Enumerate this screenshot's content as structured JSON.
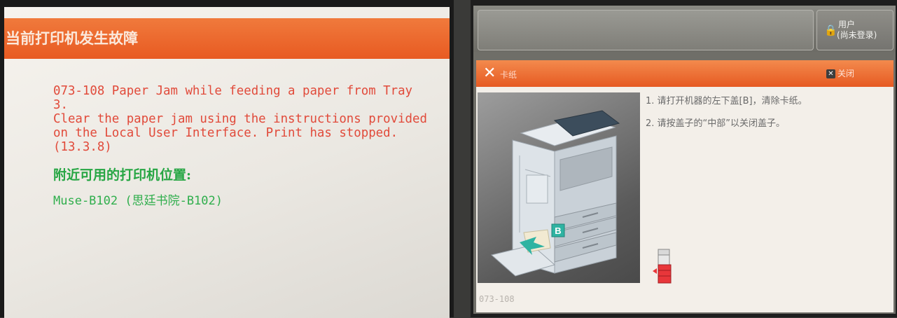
{
  "left_panel": {
    "header_title": "当前打印机发生故障",
    "error_message": "073-108 Paper Jam while feeding a paper from Tray 3.\nClear the paper jam using the instructions provided\non the Local User Interface. Print has stopped.\n(13.3.8)",
    "nearby_heading": "附近可用的打印机位置:",
    "nearby_printer": "Muse-B102 (思廷书院-B102)"
  },
  "right_panel": {
    "user_button": {
      "icon": "user-lock-icon",
      "label": "用户",
      "status": "(尚未登录)"
    },
    "dialog": {
      "title": "卡纸",
      "close_label": "关闭",
      "steps": [
        "1. 请打开机器的左下盖[B]，清除卡纸。",
        "2. 请按盖子的“中部”以关闭盖子。"
      ],
      "diagram_label": "B",
      "error_code": "073-108"
    }
  },
  "colors": {
    "header_orange": "#e85a22",
    "error_red": "#e14a3a",
    "success_green": "#27a644",
    "accent_teal": "#2fb3a2"
  }
}
